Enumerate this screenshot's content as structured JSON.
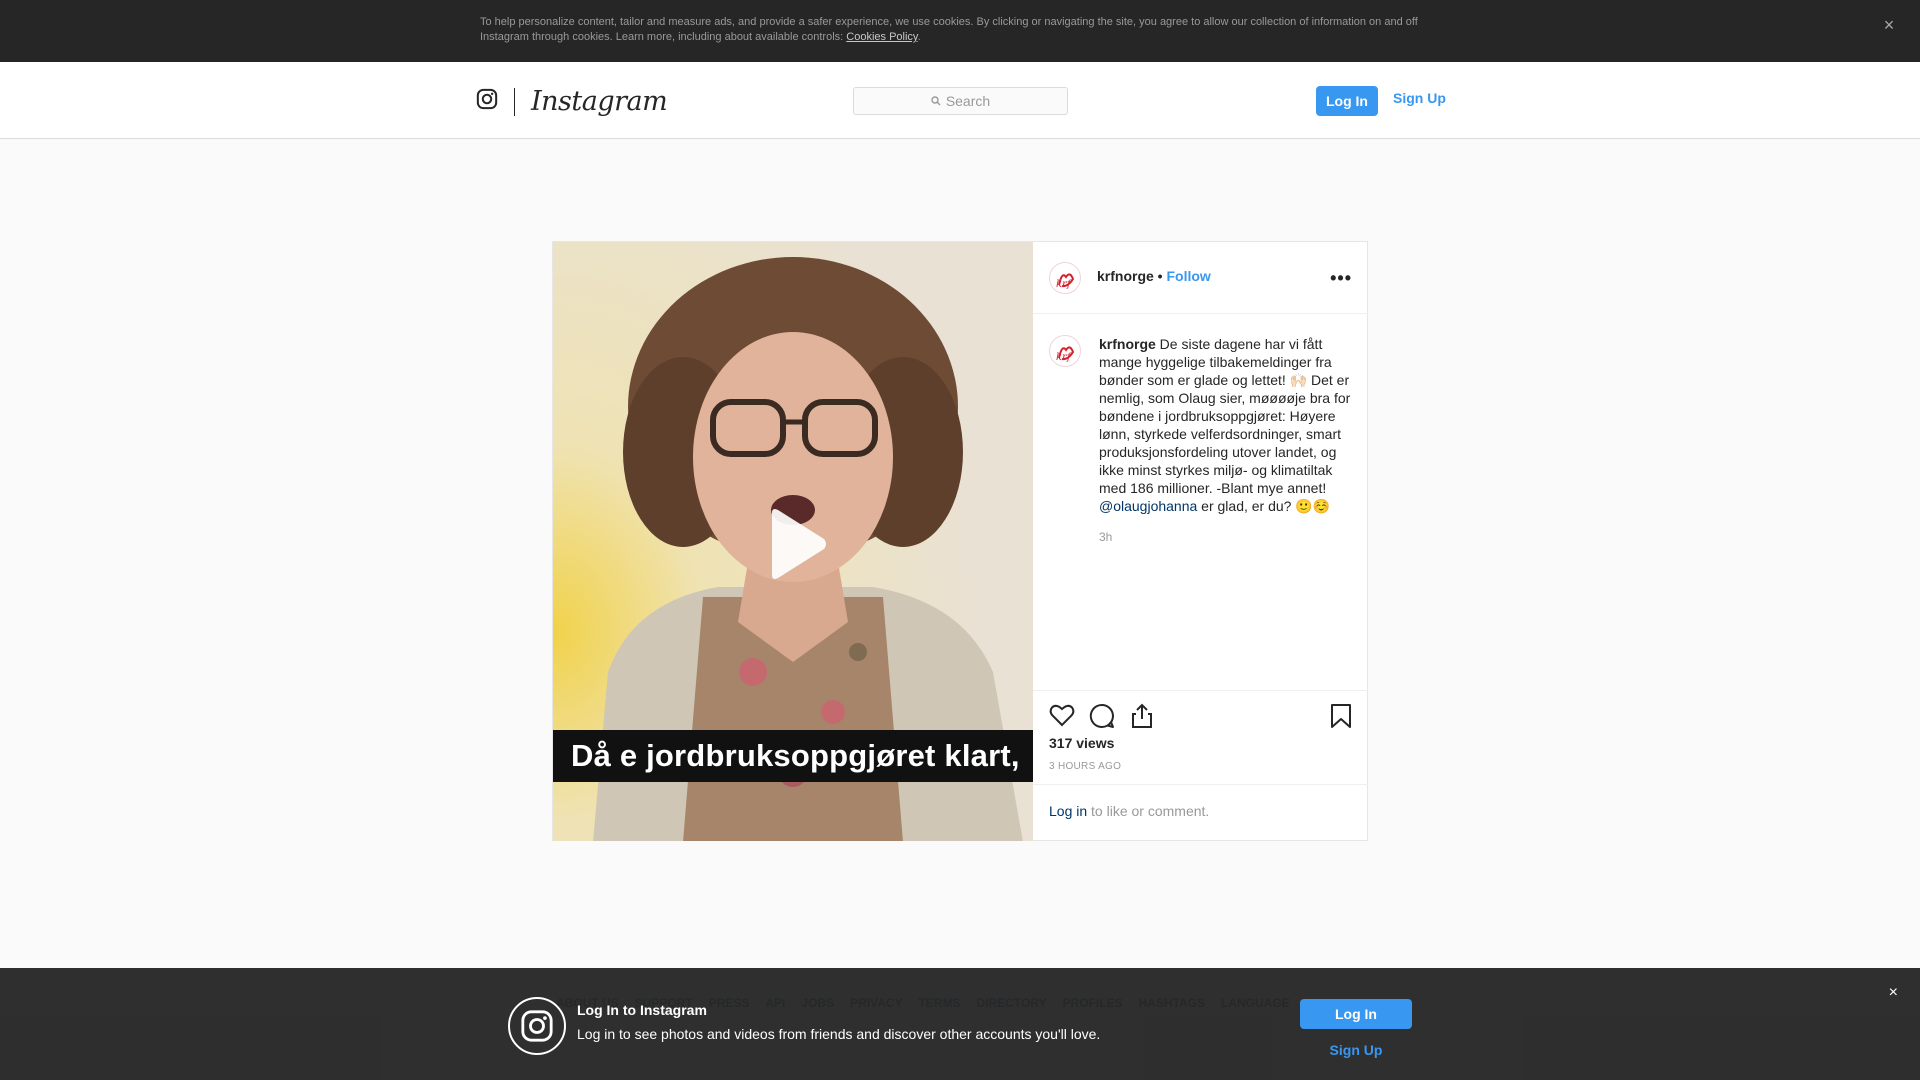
{
  "cookie_banner": {
    "text": "To help personalize content, tailor and measure ads, and provide a safer experience, we use cookies. By clicking or navigating the site, you agree to allow our collection of information on and off Instagram through cookies. Learn more, including about available controls: ",
    "link": "Cookies Policy",
    "end": ".",
    "close": "×"
  },
  "nav": {
    "wordmark": "Instagram",
    "search_placeholder": "Search",
    "login": "Log In",
    "signup": "Sign Up"
  },
  "post": {
    "video_caption": "Då e jordbruksoppgjøret klart,",
    "username": "krfnorge",
    "separator": " • ",
    "follow": "Follow",
    "more": "•••",
    "avatar_text": "krf",
    "comment": {
      "username": "krfnorge",
      "text": " De siste dagene har vi fått mange hyggelige tilbakemeldinger fra bønder som er glade og lettet! 🙌🏻 Det er nemlig, som Olaug sier, møøøøje bra for bøndene i jordbruksoppgjøret: Høyere lønn, styrkede velferdsordninger, smart produksjonsfordeling utover landet, og ikke minst styrkes miljø- og klimatiltak med 186 millioner. -Blant mye annet! ",
      "mention": "@olaugjohanna",
      "tail": " er glad, er du? 🙂☺️",
      "time": "3h"
    },
    "views": "317 views",
    "ago": "3 HOURS AGO",
    "login_link": "Log in",
    "login_rest": " to like or comment."
  },
  "footer": {
    "links": [
      "ABOUT US",
      "SUPPORT",
      "PRESS",
      "API",
      "JOBS",
      "PRIVACY",
      "TERMS",
      "DIRECTORY",
      "PROFILES",
      "HASHTAGS",
      "LANGUAGE"
    ]
  },
  "bottom_banner": {
    "title": "Log In to Instagram",
    "subtitle": "Log in to see photos and videos from friends and discover other accounts you'll love.",
    "login": "Log In",
    "signup": "Sign Up",
    "close": "×"
  },
  "colors": {
    "accent": "#3897f0",
    "link": "#003569",
    "banner_bg": "#262626"
  }
}
